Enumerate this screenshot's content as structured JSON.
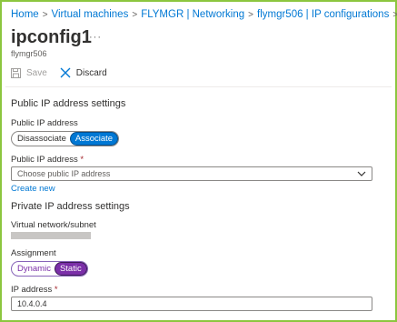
{
  "breadcrumb": [
    {
      "label": "Home"
    },
    {
      "label": "Virtual machines"
    },
    {
      "label": "FLYMGR | Networking"
    },
    {
      "label": "flymgr506 | IP configurations"
    }
  ],
  "page": {
    "title": "ipconfig1",
    "more": "···",
    "subtitle": "flymgr506"
  },
  "toolbar": {
    "save_label": "Save",
    "discard_label": "Discard"
  },
  "public_ip": {
    "section_title": "Public IP address settings",
    "toggle_label": "Public IP address",
    "options": [
      "Disassociate",
      "Associate"
    ],
    "selected": "Associate",
    "select_label": "Public IP address",
    "required_mark": "*",
    "select_placeholder": "Choose public IP address",
    "create_new": "Create new"
  },
  "private_ip": {
    "section_title": "Private IP address settings",
    "vnet_label": "Virtual network/subnet",
    "assignment_label": "Assignment",
    "options": [
      "Dynamic",
      "Static"
    ],
    "selected": "Static",
    "ip_label": "IP address",
    "required_mark": "*",
    "ip_value": "10.4.0.4"
  },
  "colors": {
    "accent": "#0078d4",
    "static_purple": "#7b2fa8",
    "frame_border": "#8cc63f",
    "required": "#a4262c"
  }
}
